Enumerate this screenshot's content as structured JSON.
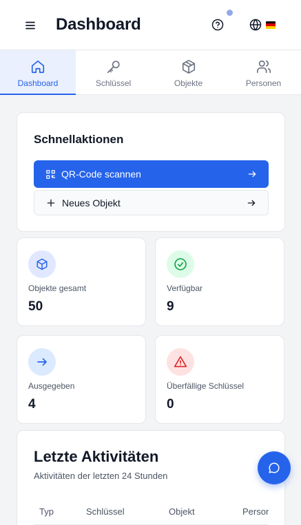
{
  "header": {
    "title": "Dashboard",
    "menu_icon": "menu-icon",
    "help_icon": "help-circle-icon",
    "lang_icon": "globe-icon",
    "flag": "de-flag-icon"
  },
  "tabs": [
    {
      "label": "Dashboard",
      "icon": "home-icon",
      "active": true
    },
    {
      "label": "Schlüssel",
      "icon": "key-icon",
      "active": false
    },
    {
      "label": "Objekte",
      "icon": "box-icon",
      "active": false
    },
    {
      "label": "Personen",
      "icon": "users-icon",
      "active": false
    }
  ],
  "quick_actions": {
    "title": "Schnellaktionen",
    "primary": {
      "label": "QR-Code scannen",
      "icon": "qr-code-icon"
    },
    "secondary": {
      "label": "Neues Objekt",
      "icon": "plus-icon"
    }
  },
  "stats": [
    {
      "label": "Objekte gesamt",
      "value": "50",
      "icon": "box-icon",
      "color": "#2563eb",
      "bg": "#e0e7ff"
    },
    {
      "label": "Verfügbar",
      "value": "9",
      "icon": "check-circle-icon",
      "color": "#16a34a",
      "bg": "#dcfce7"
    },
    {
      "label": "Ausgegeben",
      "value": "4",
      "icon": "arrow-right-icon",
      "color": "#2563eb",
      "bg": "#dbeafe"
    },
    {
      "label": "Überfällige Schlüssel",
      "value": "0",
      "icon": "alert-triangle-icon",
      "color": "#dc2626",
      "bg": "#fee2e2"
    }
  ],
  "activity": {
    "title": "Letzte Aktivitäten",
    "subtitle": "Aktivitäten der letzten 24 Stunden",
    "columns": [
      "Typ",
      "Schlüssel",
      "Objekt",
      "Person"
    ]
  },
  "fab": {
    "icon": "chat-icon"
  },
  "colors": {
    "accent": "#2563eb",
    "notification_dot": "#93a8e8"
  }
}
